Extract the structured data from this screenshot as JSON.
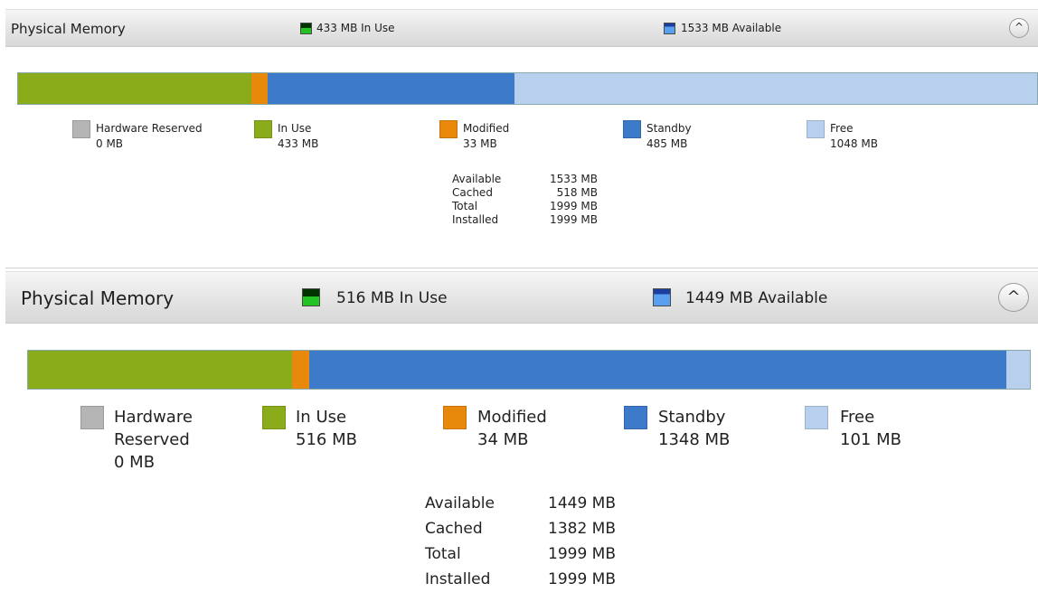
{
  "colors": {
    "hardware_reserved": "#b5b5b5",
    "in_use": "#8bac1a",
    "modified": "#e8890c",
    "standby": "#3d7ac9",
    "free": "#b8d0ee"
  },
  "panels": [
    {
      "title": "Physical Memory",
      "in_use_summary": "433 MB In Use",
      "available_summary": "1533 MB Available",
      "header_icons": [
        "memory-in-use-icon",
        "memory-available-icon",
        "collapse-chevron-icon"
      ],
      "bar_fractions": {
        "hardware_reserved": 0,
        "in_use": 0.2286,
        "modified": 0.0166,
        "standby": 0.2418,
        "free": 0.513
      },
      "legend": {
        "hardware_reserved": {
          "label": "Hardware Reserved",
          "value": "0 MB"
        },
        "in_use": {
          "label": "In Use",
          "value": "433 MB"
        },
        "modified": {
          "label": "Modified",
          "value": "33 MB"
        },
        "standby": {
          "label": "Standby",
          "value": "485 MB"
        },
        "free": {
          "label": "Free",
          "value": "1048 MB"
        }
      },
      "stats": [
        {
          "label": "Available",
          "value": "1533 MB"
        },
        {
          "label": "Cached",
          "value": "518 MB"
        },
        {
          "label": "Total",
          "value": "1999 MB"
        },
        {
          "label": "Installed",
          "value": "1999 MB"
        }
      ]
    },
    {
      "title": "Physical Memory",
      "in_use_summary": "516 MB In Use",
      "available_summary": "1449 MB Available",
      "header_icons": [
        "memory-in-use-icon",
        "memory-available-icon",
        "collapse-chevron-icon"
      ],
      "bar_fractions": {
        "hardware_reserved": 0,
        "in_use": 0.2637,
        "modified": 0.0174,
        "standby": 0.6951,
        "free": 0.0238
      },
      "legend": {
        "hardware_reserved": {
          "label": "Hardware Reserved",
          "label_line1": "Hardware",
          "label_line2": "Reserved",
          "value": "0 MB"
        },
        "in_use": {
          "label": "In Use",
          "value": "516 MB"
        },
        "modified": {
          "label": "Modified",
          "value": "34 MB"
        },
        "standby": {
          "label": "Standby",
          "value": "1348 MB"
        },
        "free": {
          "label": "Free",
          "value": "101 MB"
        }
      },
      "stats": [
        {
          "label": "Available",
          "value": "1449 MB"
        },
        {
          "label": "Cached",
          "value": "1382 MB"
        },
        {
          "label": "Total",
          "value": "1999 MB"
        },
        {
          "label": "Installed",
          "value": "1999 MB"
        }
      ]
    }
  ]
}
